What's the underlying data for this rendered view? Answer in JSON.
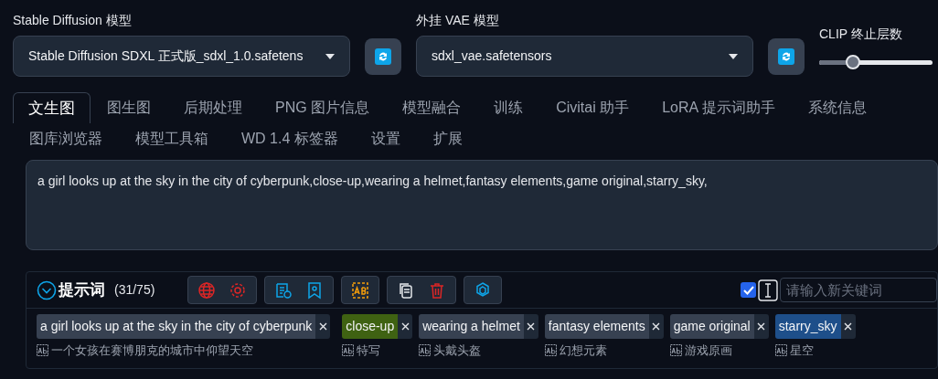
{
  "model_selectors": [
    {
      "label": "Stable Diffusion 模型",
      "value": "Stable Diffusion SDXL 正式版_sdxl_1.0.safetens"
    },
    {
      "label": "外挂 VAE 模型",
      "value": "sdxl_vae.safetensors"
    }
  ],
  "clip_skip": {
    "label": "CLIP 终止层数",
    "level": 0.3
  },
  "tabs": [
    {
      "label": "文生图",
      "selected": true
    },
    {
      "label": "图生图",
      "selected": false
    },
    {
      "label": "后期处理",
      "selected": false
    },
    {
      "label": "PNG 图片信息",
      "selected": false
    },
    {
      "label": "模型融合",
      "selected": false
    },
    {
      "label": "训练",
      "selected": false
    },
    {
      "label": "Civitai 助手",
      "selected": false
    },
    {
      "label": "LoRA 提示词助手",
      "selected": false
    },
    {
      "label": "系统信息",
      "selected": false
    },
    {
      "label": "图库浏览器",
      "selected": false
    },
    {
      "label": "模型工具箱",
      "selected": false
    },
    {
      "label": "WD 1.4 标签器",
      "selected": false
    },
    {
      "label": "设置",
      "selected": false
    },
    {
      "label": "扩展",
      "selected": false
    }
  ],
  "prompt": "a girl looks up at the sky in the city of cyberpunk,close-up,wearing a helmet,fantasy elements,game original,starry_sky,",
  "prompt_panel": {
    "title": "提示词",
    "count": "(31/75)",
    "expanded": true,
    "checkbox_checked": true,
    "keyword_placeholder": "请输入新关键词",
    "tags": [
      {
        "text": "a girl looks up at the sky in the city of cyberpunk",
        "translation": "一个女孩在赛博朋克的城市中仰望天空",
        "color": "#374151"
      },
      {
        "text": "close-up",
        "translation": "特写",
        "color": "#3f6212"
      },
      {
        "text": "wearing a helmet",
        "translation": "头戴头盔",
        "color": "#374151"
      },
      {
        "text": "fantasy elements",
        "translation": "幻想元素",
        "color": "#374151"
      },
      {
        "text": "game original",
        "translation": "游戏原画",
        "color": "#374151"
      },
      {
        "text": "starry_sky",
        "translation": "星空",
        "color": "#1e4f8a"
      }
    ]
  }
}
